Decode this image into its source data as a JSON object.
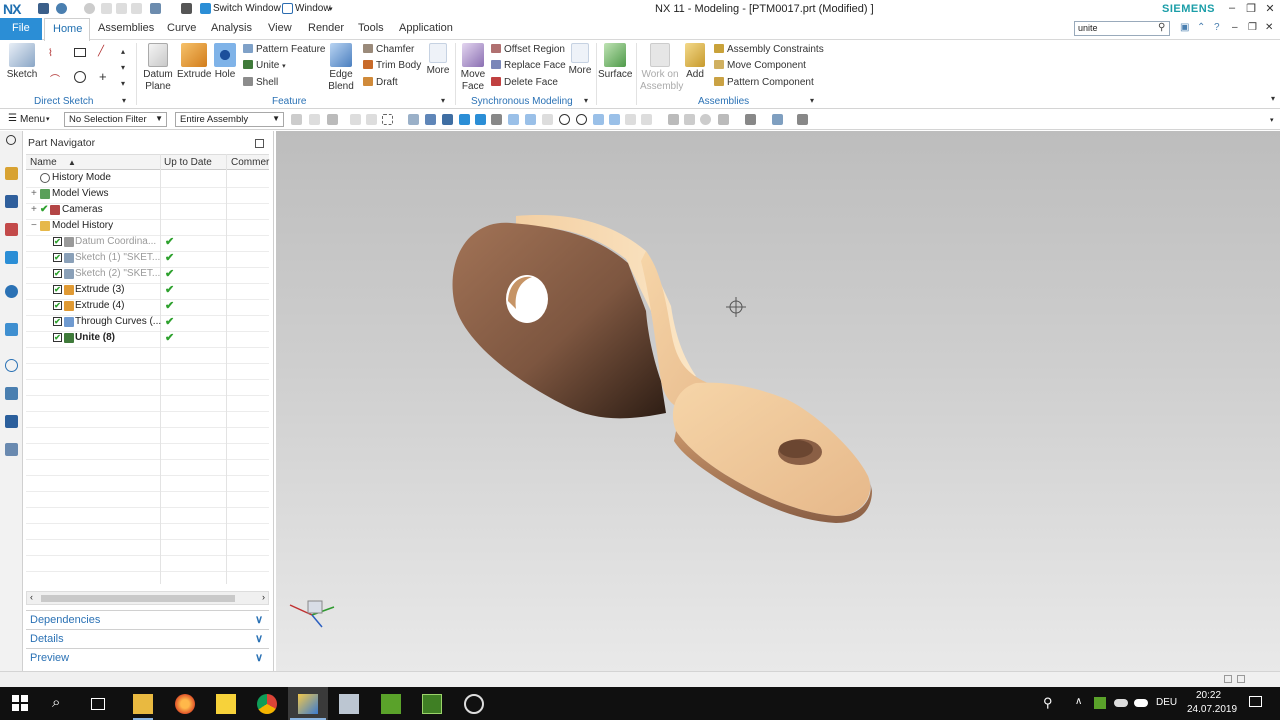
{
  "app": {
    "logo": "NX",
    "window_title": "NX 11 - Modeling - [PTM0017.prt (Modified) ]",
    "brand": "SIEMENS",
    "switch_window": "Switch Window",
    "window_menu": "Window"
  },
  "tabs": {
    "file": "File",
    "items": [
      "Home",
      "Assemblies",
      "Curve",
      "Analysis",
      "View",
      "Render",
      "Tools",
      "Application"
    ]
  },
  "search": {
    "value": "unite"
  },
  "ribbon": {
    "direct_sketch": {
      "sketch": "Sketch",
      "label": "Direct Sketch"
    },
    "feature": {
      "datum_plane": "Datum Plane",
      "extrude": "Extrude",
      "hole": "Hole",
      "pattern_feature": "Pattern Feature",
      "unite": "Unite",
      "shell": "Shell",
      "edge_blend": "Edge Blend",
      "chamfer": "Chamfer",
      "trim_body": "Trim Body",
      "draft": "Draft",
      "more": "More",
      "label": "Feature"
    },
    "sync": {
      "move_face": "Move Face",
      "offset_region": "Offset Region",
      "replace_face": "Replace Face",
      "delete_face": "Delete Face",
      "more": "More",
      "label": "Synchronous Modeling"
    },
    "surface": {
      "surface": "Surface"
    },
    "assemblies": {
      "work_on_assembly": "Work on Assembly",
      "add": "Add",
      "assembly_constraints": "Assembly Constraints",
      "move_component": "Move Component",
      "pattern_component": "Pattern Component",
      "label": "Assemblies"
    }
  },
  "toolbar": {
    "menu": "Menu",
    "selection_filter": "No Selection Filter",
    "scope": "Entire Assembly"
  },
  "navigator": {
    "title": "Part Navigator",
    "columns": [
      "Name",
      "Up to Date",
      "Commer"
    ],
    "rows": [
      {
        "label": "History Mode",
        "checked": false,
        "uptodate": ""
      },
      {
        "label": "Model Views",
        "checked": false,
        "uptodate": ""
      },
      {
        "label": "Cameras",
        "checked": true,
        "uptodate": ""
      },
      {
        "label": "Model History",
        "checked": false,
        "uptodate": ""
      },
      {
        "label": "Datum Coordina...",
        "checked": true,
        "uptodate": "✔"
      },
      {
        "label": "Sketch (1) \"SKET...",
        "checked": true,
        "uptodate": "✔"
      },
      {
        "label": "Sketch (2) \"SKET...",
        "checked": true,
        "uptodate": "✔"
      },
      {
        "label": "Extrude (3)",
        "checked": true,
        "uptodate": "✔"
      },
      {
        "label": "Extrude (4)",
        "checked": true,
        "uptodate": "✔"
      },
      {
        "label": "Through Curves (...",
        "checked": true,
        "uptodate": "✔"
      },
      {
        "label": "Unite (8)",
        "checked": true,
        "uptodate": "✔"
      }
    ],
    "panels": [
      "Dependencies",
      "Details",
      "Preview"
    ]
  },
  "taskbar": {
    "lang": "DEU",
    "time": "20:22",
    "date": "24.07.2019"
  },
  "colors": {
    "accent": "#2b8ed6",
    "group_label": "#2b72b5",
    "check": "#2ea12e",
    "part_light": "#f6d8ae",
    "part_dark": "#8a5f45"
  }
}
